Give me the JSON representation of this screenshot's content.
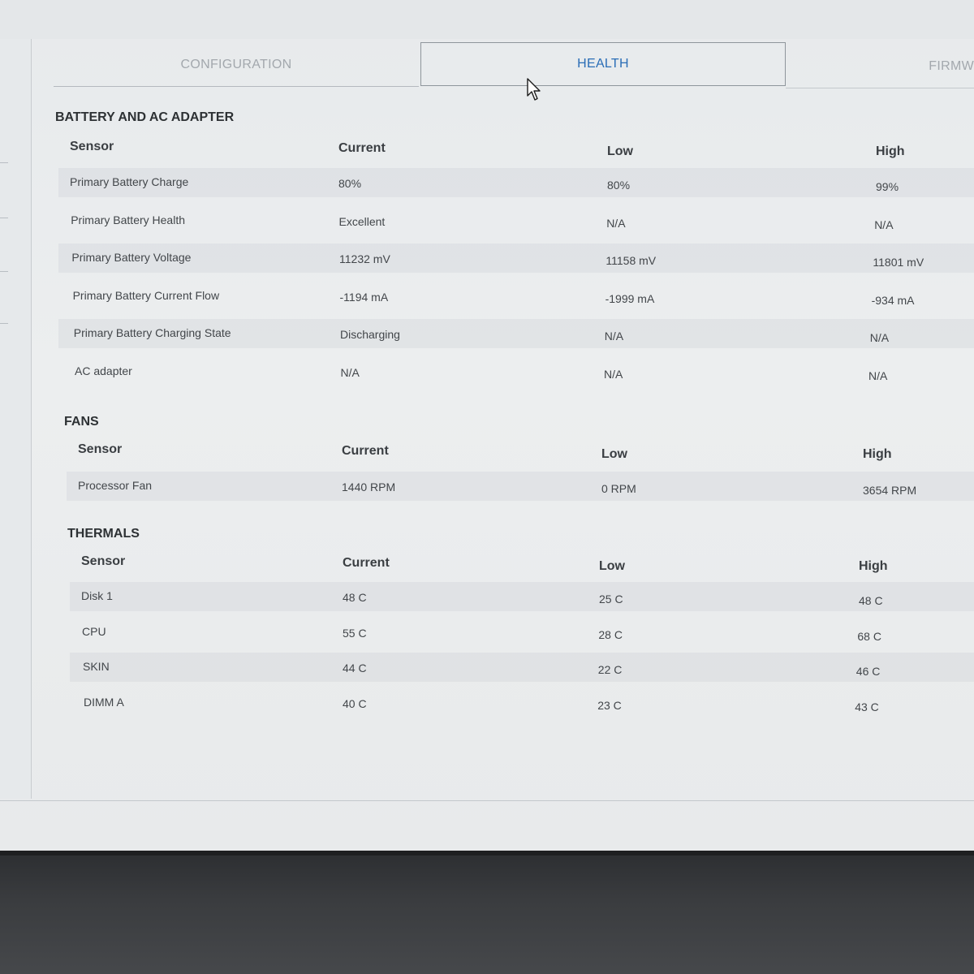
{
  "tabs": {
    "configuration": "CONFIGURATION",
    "health": "HEALTH",
    "firmware": "FIRMW"
  },
  "columns": {
    "sensor": "Sensor",
    "current": "Current",
    "low": "Low",
    "high": "High"
  },
  "battery": {
    "title": "BATTERY AND AC ADAPTER",
    "rows": [
      {
        "sensor": "Primary Battery Charge",
        "current": "80%",
        "low": "80%",
        "high": "99%"
      },
      {
        "sensor": "Primary Battery Health",
        "current": "Excellent",
        "low": "N/A",
        "high": "N/A"
      },
      {
        "sensor": "Primary Battery Voltage",
        "current": "11232 mV",
        "low": "11158 mV",
        "high": "11801 mV"
      },
      {
        "sensor": "Primary Battery Current Flow",
        "current": "-1194 mA",
        "low": "-1999 mA",
        "high": "-934 mA"
      },
      {
        "sensor": "Primary Battery Charging State",
        "current": "Discharging",
        "low": "N/A",
        "high": "N/A"
      },
      {
        "sensor": "AC adapter",
        "current": "N/A",
        "low": "N/A",
        "high": "N/A"
      }
    ]
  },
  "fans": {
    "title": "FANS",
    "rows": [
      {
        "sensor": "Processor Fan",
        "current": "1440 RPM",
        "low": "0 RPM",
        "high": "3654 RPM"
      }
    ]
  },
  "thermals": {
    "title": "THERMALS",
    "rows": [
      {
        "sensor": "Disk 1",
        "current": "48 C",
        "low": "25 C",
        "high": "48 C"
      },
      {
        "sensor": "CPU",
        "current": "55 C",
        "low": "28 C",
        "high": "68 C"
      },
      {
        "sensor": "SKIN",
        "current": "44 C",
        "low": "22 C",
        "high": "46 C"
      },
      {
        "sensor": "DIMM A",
        "current": "40 C",
        "low": "23 C",
        "high": "43 C"
      }
    ]
  }
}
